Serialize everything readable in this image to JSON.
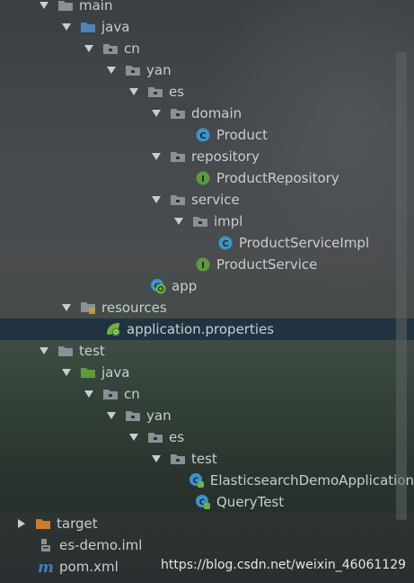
{
  "tree": [
    {
      "label": "main",
      "kind": "folder",
      "expanded": true
    },
    {
      "label": "java",
      "kind": "folder-src",
      "expanded": true
    },
    {
      "label": "cn",
      "kind": "package",
      "expanded": true
    },
    {
      "label": "yan",
      "kind": "package",
      "expanded": true
    },
    {
      "label": "es",
      "kind": "package",
      "expanded": true
    },
    {
      "label": "domain",
      "kind": "package",
      "expanded": true
    },
    {
      "label": "Product",
      "kind": "class"
    },
    {
      "label": "repository",
      "kind": "package",
      "expanded": true
    },
    {
      "label": "ProductRepository",
      "kind": "interface"
    },
    {
      "label": "service",
      "kind": "package",
      "expanded": true
    },
    {
      "label": "impl",
      "kind": "package",
      "expanded": true
    },
    {
      "label": "ProductServiceImpl",
      "kind": "class"
    },
    {
      "label": "ProductService",
      "kind": "interface"
    },
    {
      "label": "app",
      "kind": "spring-class"
    },
    {
      "label": "resources",
      "kind": "folder-resources",
      "expanded": true
    },
    {
      "label": "application.properties",
      "kind": "spring-properties",
      "selected": true
    },
    {
      "label": "test",
      "kind": "folder",
      "expanded": true
    },
    {
      "label": "java",
      "kind": "folder-test",
      "expanded": true
    },
    {
      "label": "cn",
      "kind": "package",
      "expanded": true
    },
    {
      "label": "yan",
      "kind": "package",
      "expanded": true
    },
    {
      "label": "es",
      "kind": "package",
      "expanded": true
    },
    {
      "label": "test",
      "kind": "package",
      "expanded": true
    },
    {
      "label": "ElasticsearchDemoApplication",
      "kind": "test-class"
    },
    {
      "label": "QueryTest",
      "kind": "test-class"
    },
    {
      "label": "target",
      "kind": "folder-excluded",
      "expanded": false
    },
    {
      "label": "es-demo.iml",
      "kind": "iml-file"
    },
    {
      "label": "pom.xml",
      "kind": "maven-file"
    }
  ],
  "watermark": "https://blog.csdn.net/weixin_46061129",
  "colors": {
    "selection": "#1c3040",
    "package_folder": "#8a9096",
    "source_folder": "#4d83b8",
    "test_folder": "#5f9a3c",
    "excluded_folder": "#d07a2f",
    "class_icon": "#3a95c8",
    "interface_icon": "#5c9a3a",
    "spring_green": "#6db33f",
    "maven_blue": "#3d80c2"
  }
}
